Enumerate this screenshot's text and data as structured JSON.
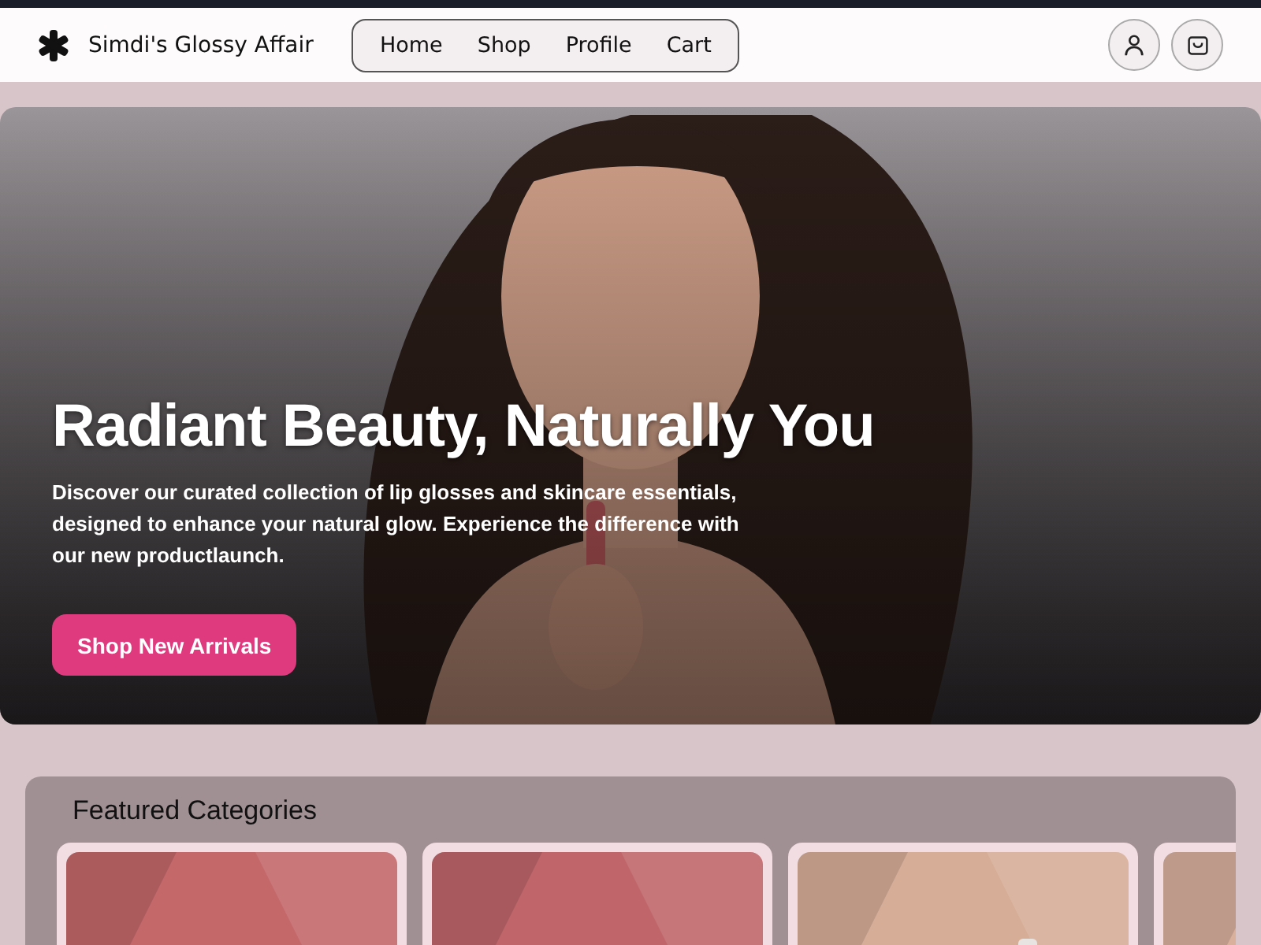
{
  "header": {
    "brand": "Simdi's Glossy Affair",
    "nav": [
      {
        "label": "Home"
      },
      {
        "label": "Shop"
      },
      {
        "label": "Profile"
      },
      {
        "label": "Cart"
      }
    ]
  },
  "hero": {
    "kind": "picture",
    "title": "Radiant Beauty, Naturally You",
    "text": "Discover our curated collection of lip glosses and skincare essentials, designed to enhance your natural glow. Experience the difference with our new productlaunch.",
    "button": "Shop New Arrivals"
  },
  "featured": {
    "title": "Featured Categories"
  }
}
